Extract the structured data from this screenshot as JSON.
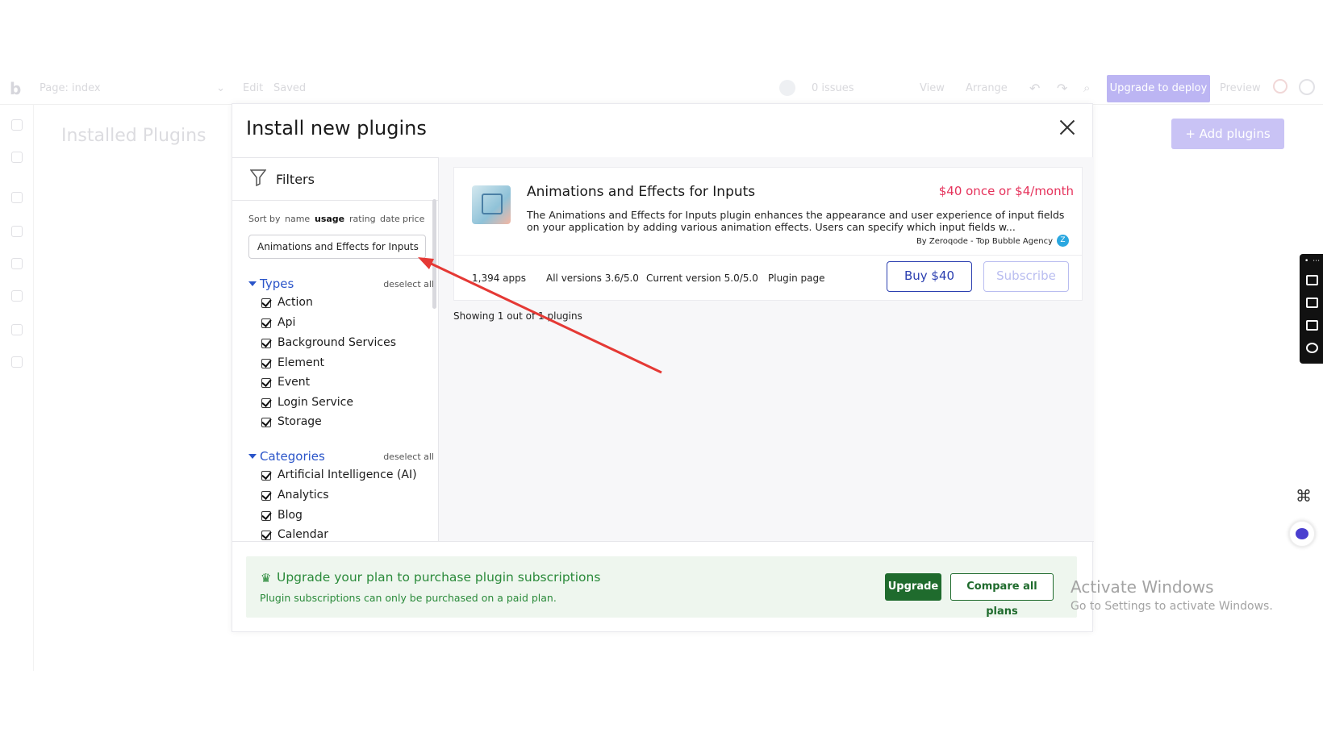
{
  "editor": {
    "logo": "b",
    "page_selector": "Page: index",
    "edit": "Edit",
    "saved": "Saved",
    "issues": "0 issues",
    "view": "View",
    "arrange": "Arrange",
    "deploy": "Upgrade to deploy",
    "preview": "Preview",
    "installed_title": "Installed Plugins",
    "add_plugins": "Add plugins"
  },
  "modal": {
    "title": "Install new plugins",
    "filters_label": "Filters",
    "sort": {
      "label": "Sort by",
      "options": [
        "name",
        "usage",
        "rating",
        "date",
        "price"
      ],
      "active": "usage"
    },
    "search_value": "Animations and Effects for Inputs",
    "types": {
      "title": "Types",
      "deselect": "deselect all",
      "items": [
        "Action",
        "Api",
        "Background Services",
        "Element",
        "Event",
        "Login Service",
        "Storage"
      ]
    },
    "categories": {
      "title": "Categories",
      "deselect": "deselect all",
      "items": [
        "Artificial Intelligence (AI)",
        "Analytics",
        "Blog",
        "Calendar"
      ]
    },
    "plugin": {
      "name": "Animations and Effects for Inputs",
      "price": "$40 once or $4/month",
      "description": "The Animations and Effects for Inputs plugin enhances the appearance and user experience of input fields on your application by adding various animation effects. Users can specify which input fields w...",
      "author": "By Zeroqode - Top Bubble Agency",
      "apps": "1,394 apps",
      "all_versions": "All versions 3.6/5.0",
      "current_version": "Current version 5.0/5.0",
      "plugin_page": "Plugin page",
      "buy": "Buy $40",
      "subscribe": "Subscribe"
    },
    "showing": "Showing 1 out of 1 plugins",
    "banner": {
      "title": "Upgrade your plan to purchase plugin subscriptions",
      "subtitle": "Plugin subscriptions can only be purchased on a paid plan.",
      "upgrade": "Upgrade",
      "compare": "Compare all plans"
    }
  },
  "windows": {
    "activate_title": "Activate Windows",
    "activate_sub": "Go to Settings to activate Windows."
  },
  "colors": {
    "accent_blue": "#2b55c9",
    "price_red": "#e5325b",
    "upgrade_green": "#1f6b2d",
    "arrow_red": "#e53935"
  }
}
